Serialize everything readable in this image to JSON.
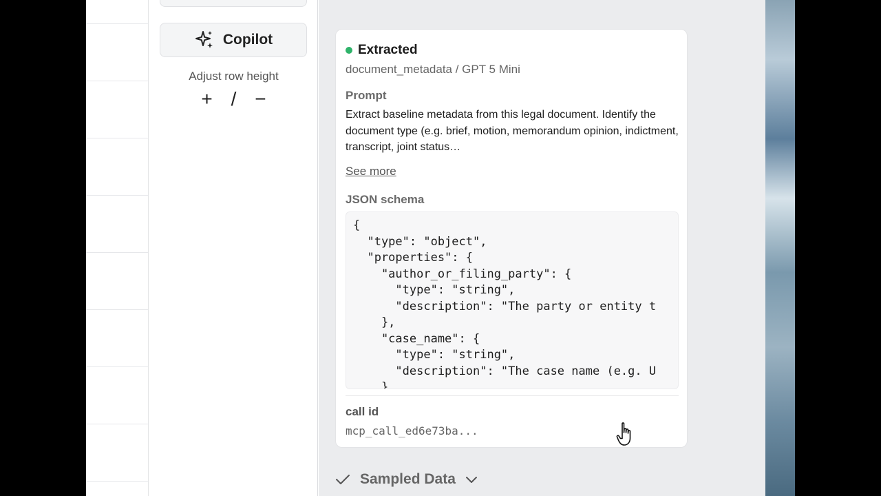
{
  "sidebar": {
    "copilot_label": "Copilot",
    "copilot_icon": "sparkles-icon",
    "row_height_label": "Adjust row height",
    "increase": "+",
    "separator": "/",
    "decrease": "−"
  },
  "card": {
    "status": "Extracted",
    "status_color": "#2fb36a",
    "subtitle": "document_metadata / GPT 5 Mini",
    "prompt_label": "Prompt",
    "prompt_text": "Extract baseline metadata from this legal document. Identify the document type (e.g. brief, motion, memorandum opinion, indictment, transcript, joint status…",
    "see_more": "See more",
    "schema_label": "JSON schema",
    "schema_text": "{\n  \"type\": \"object\",\n  \"properties\": {\n    \"author_or_filing_party\": {\n      \"type\": \"string\",\n      \"description\": \"The party or entity t\n    },\n    \"case_name\": {\n      \"type\": \"string\",\n      \"description\": \"The case name (e.g. U\n    }",
    "call_id_label": "call id",
    "call_id_value": "mcp_call_ed6e73ba..."
  },
  "sampled": {
    "label": "Sampled Data",
    "check_icon": "check-icon",
    "chevron_icon": "chevron-down-icon"
  }
}
